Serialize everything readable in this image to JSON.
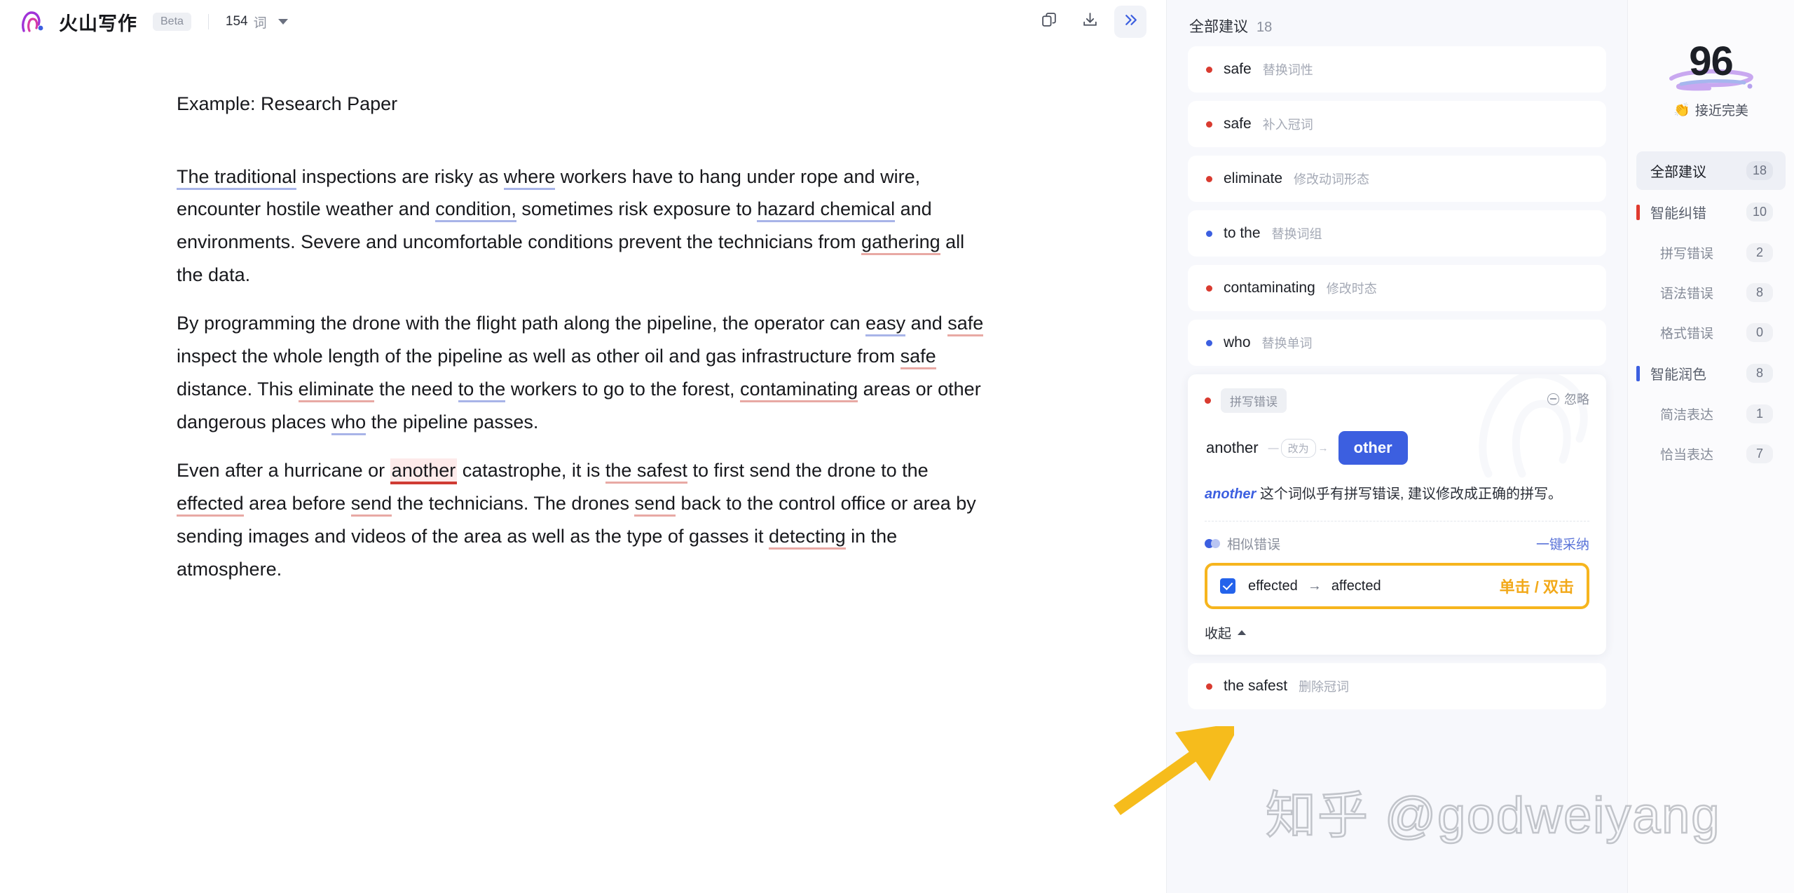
{
  "header": {
    "brand_name": "火山写作",
    "beta_label": "Beta",
    "word_count": "154",
    "word_unit": "词",
    "copy_icon": "copy-icon",
    "download_icon": "download-icon",
    "collapse_icon": "double-chevron-right-icon"
  },
  "document": {
    "title": "Example: Research Paper",
    "paragraphs": [
      {
        "segments": [
          {
            "t": "The traditional",
            "style": "u-blue"
          },
          {
            "t": " inspections are risky as ",
            "style": ""
          },
          {
            "t": "where",
            "style": "u-blue"
          },
          {
            "t": " workers have to hang under rope and wire, encounter hostile weather and ",
            "style": ""
          },
          {
            "t": "condition,",
            "style": "u-blue"
          },
          {
            "t": " sometimes risk exposure to ",
            "style": ""
          },
          {
            "t": "hazard chemical",
            "style": "u-blue"
          },
          {
            "t": " and environments. Severe and uncomfortable conditions prevent the technicians from ",
            "style": ""
          },
          {
            "t": "gathering",
            "style": "u-red"
          },
          {
            "t": " all the data.",
            "style": ""
          }
        ]
      },
      {
        "segments": [
          {
            "t": "By programming the drone with the flight path along the pipeline, the operator can ",
            "style": ""
          },
          {
            "t": "easy",
            "style": "u-blue"
          },
          {
            "t": " and ",
            "style": ""
          },
          {
            "t": "safe",
            "style": "u-red"
          },
          {
            "t": " inspect the whole length of the pipeline as well as other oil and gas infrastructure from ",
            "style": ""
          },
          {
            "t": "safe",
            "style": "u-red"
          },
          {
            "t": " distance. This ",
            "style": ""
          },
          {
            "t": "eliminate",
            "style": "u-red"
          },
          {
            "t": " the need ",
            "style": ""
          },
          {
            "t": "to the",
            "style": "u-blue"
          },
          {
            "t": " workers to go to the forest, ",
            "style": ""
          },
          {
            "t": "contaminating",
            "style": "u-red"
          },
          {
            "t": " areas or other dangerous places ",
            "style": ""
          },
          {
            "t": "who",
            "style": "u-blue"
          },
          {
            "t": " the pipeline passes.",
            "style": ""
          }
        ]
      },
      {
        "segments": [
          {
            "t": "Even after a hurricane or ",
            "style": ""
          },
          {
            "t": "another",
            "style": "u-active"
          },
          {
            "t": " catastrophe, it is ",
            "style": ""
          },
          {
            "t": "the safest",
            "style": "u-red"
          },
          {
            "t": " to first send the drone to the ",
            "style": ""
          },
          {
            "t": "effected",
            "style": "u-red"
          },
          {
            "t": " area before ",
            "style": ""
          },
          {
            "t": "send",
            "style": "u-red"
          },
          {
            "t": " the technicians. The drones ",
            "style": ""
          },
          {
            "t": "send",
            "style": "u-red"
          },
          {
            "t": " back to the control office or area by sending images and videos of the area as well as the type of gasses it ",
            "style": ""
          },
          {
            "t": "detecting",
            "style": "u-red"
          },
          {
            "t": " in the atmosphere.",
            "style": ""
          }
        ]
      }
    ]
  },
  "suggestions": {
    "header_label": "全部建议",
    "header_count": "18",
    "items": [
      {
        "word": "safe",
        "type": "替换词性",
        "dot": "red"
      },
      {
        "word": "safe",
        "type": "补入冠词",
        "dot": "red"
      },
      {
        "word": "eliminate",
        "type": "修改动词形态",
        "dot": "red"
      },
      {
        "word": "to the",
        "type": "替换词组",
        "dot": "blue"
      },
      {
        "word": "contaminating",
        "type": "修改时态",
        "dot": "red"
      },
      {
        "word": "who",
        "type": "替换单词",
        "dot": "blue"
      }
    ],
    "expanded": {
      "tag": "拼写错误",
      "dot": "red",
      "ignore_label": "忽略",
      "from_word": "another",
      "change_label": "改为",
      "to_word": "other",
      "description_word": "another",
      "description_rest": " 这个词似乎有拼写错误, 建议修改成正确的拼写。",
      "similar_label": "相似错误",
      "adopt_all_label": "一键采纳",
      "similar_item": {
        "from": "effected",
        "arrow": "→",
        "to": "affected",
        "annotation": "单击 / 双击",
        "checked": true
      },
      "collapse_label": "收起"
    },
    "trailing_item": {
      "word": "the safest",
      "type": "删除冠词",
      "dot": "red"
    }
  },
  "rail": {
    "score": "96",
    "score_emoji": "👏",
    "score_label": "接近完美",
    "menu": [
      {
        "label": "全部建议",
        "count": "18",
        "selected": true,
        "bar": "",
        "sub": false
      },
      {
        "label": "智能纠错",
        "count": "10",
        "selected": false,
        "bar": "#e03a2f",
        "sub": false
      },
      {
        "label": "拼写错误",
        "count": "2",
        "selected": false,
        "bar": "",
        "sub": true
      },
      {
        "label": "语法错误",
        "count": "8",
        "selected": false,
        "bar": "",
        "sub": true
      },
      {
        "label": "格式错误",
        "count": "0",
        "selected": false,
        "bar": "",
        "sub": true
      },
      {
        "label": "智能润色",
        "count": "8",
        "selected": false,
        "bar": "#3c5fe0",
        "sub": false
      },
      {
        "label": "简洁表达",
        "count": "1",
        "selected": false,
        "bar": "",
        "sub": true
      },
      {
        "label": "恰当表达",
        "count": "7",
        "selected": false,
        "bar": "",
        "sub": true
      }
    ]
  },
  "overlay": {
    "watermark": "知乎 @godweiyang",
    "arrow_color": "#f6bc1c",
    "highlight_color": "#f6b51e"
  },
  "colors": {
    "accent_blue": "#3c5fe0",
    "error_red": "#d93b30",
    "highlight_yellow": "#f6b51e"
  }
}
